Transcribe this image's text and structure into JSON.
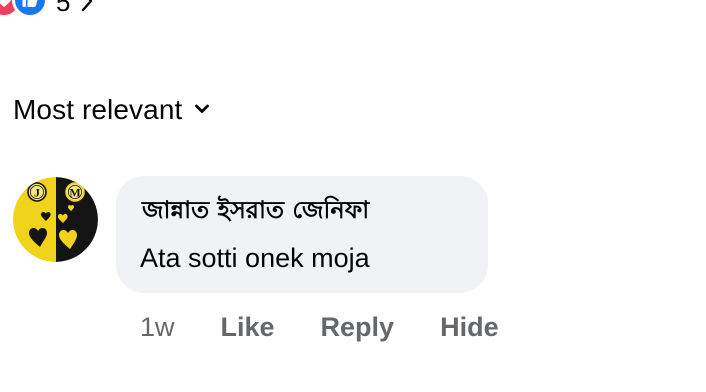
{
  "reactions": {
    "count": "5",
    "love_color": "#f33e58",
    "like_color": "#1877f2",
    "icons": [
      "heart-icon",
      "thumbs-up-icon",
      "chevron-right-icon"
    ]
  },
  "sort": {
    "label": "Most relevant",
    "icon": "chevron-down-icon"
  },
  "comment": {
    "author": "জান্নাত ইসরাত জেনিফা",
    "text": "Ata sotti onek moja",
    "avatar": {
      "letters": [
        "J",
        "M"
      ],
      "colors": {
        "left": "#f2d31b",
        "right": "#141414"
      }
    },
    "bubble_color": "#f0f2f5",
    "meta": {
      "time": "1w",
      "like_label": "Like",
      "reply_label": "Reply",
      "hide_label": "Hide"
    }
  }
}
